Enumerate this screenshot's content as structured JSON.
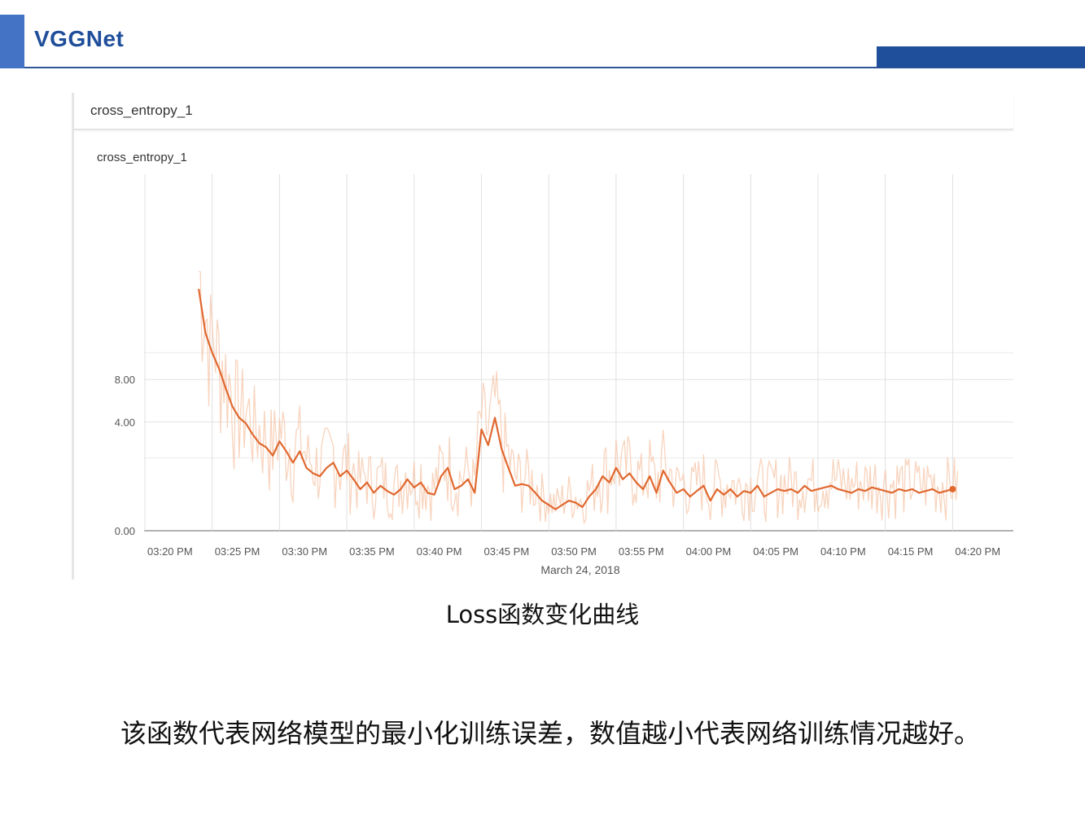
{
  "header": {
    "title": "VGGNet",
    "accent_color": "#4472c4",
    "brand_color": "#1f4e9a"
  },
  "card": {
    "tab_title": "cross_entropy_1"
  },
  "chart_data": {
    "type": "line",
    "title": "cross_entropy_1",
    "xlabel": "March 24, 2018",
    "ylabel": "",
    "x_tick_labels": [
      "03:20 PM",
      "03:25 PM",
      "03:30 PM",
      "03:35 PM",
      "03:40 PM",
      "03:45 PM",
      "03:50 PM",
      "03:55 PM",
      "04:00 PM",
      "04:05 PM",
      "04:10 PM",
      "04:15 PM",
      "04:20 PM"
    ],
    "y_tick_labels": [
      "0.00",
      "4.00",
      "8.00"
    ],
    "y_scale": "symmetric-log",
    "grid": true,
    "series": [
      {
        "color": "#e0682f",
        "smoothed_color": "#e0682f",
        "raw_color": "#f5c5a8",
        "x_minutes": [
          4,
          4.5,
          5,
          5.5,
          6,
          6.5,
          7,
          7.5,
          8,
          8.5,
          9,
          9.5,
          10,
          10.5,
          11,
          11.5,
          12,
          12.5,
          13,
          13.5,
          14,
          14.5,
          15,
          15.5,
          16,
          16.5,
          17,
          17.5,
          18,
          18.5,
          19,
          19.5,
          20,
          20.5,
          21,
          21.5,
          22,
          22.5,
          23,
          23.5,
          24,
          24.5,
          25,
          25.5,
          26,
          26.5,
          27,
          27.5,
          28,
          28.5,
          29,
          29.5,
          30,
          30.5,
          31,
          31.5,
          32,
          32.5,
          33,
          33.5,
          34,
          34.5,
          35,
          35.5,
          36,
          36.5,
          37,
          37.5,
          38,
          38.5,
          39,
          39.5,
          40,
          40.5,
          41,
          41.5,
          42,
          42.5,
          43,
          43.5,
          44,
          44.5,
          45,
          45.5,
          46,
          46.5,
          47,
          47.5,
          48,
          48.5,
          49,
          49.5,
          50,
          50.5,
          51,
          51.5,
          52,
          52.5,
          53,
          53.5,
          54,
          54.5,
          55,
          55.5,
          56,
          56.5,
          57,
          57.5,
          58,
          58.5,
          59,
          59.5,
          60
        ],
        "values": [
          30,
          16,
          12,
          9.5,
          7,
          5.2,
          4.3,
          3.9,
          3.2,
          2.7,
          2.5,
          2.1,
          2.8,
          2.3,
          1.8,
          2.3,
          1.6,
          1.4,
          1.3,
          1.6,
          1.8,
          1.3,
          1.5,
          1.2,
          0.9,
          1.1,
          0.8,
          1.0,
          0.85,
          0.75,
          0.9,
          1.2,
          0.95,
          1.1,
          0.8,
          0.75,
          1.3,
          1.6,
          0.9,
          1.0,
          1.2,
          0.8,
          3.5,
          2.6,
          4.3,
          2.4,
          1.6,
          1.0,
          1.05,
          1.0,
          0.8,
          0.6,
          0.5,
          0.4,
          0.5,
          0.6,
          0.55,
          0.45,
          0.7,
          0.9,
          1.3,
          1.1,
          1.6,
          1.2,
          1.4,
          1.1,
          0.9,
          1.3,
          0.8,
          1.5,
          1.1,
          0.8,
          0.9,
          0.7,
          0.85,
          1.0,
          0.6,
          0.9,
          0.75,
          0.9,
          0.7,
          0.85,
          0.8,
          1.0,
          0.7,
          0.8,
          0.9,
          0.85,
          0.9,
          0.8,
          1.0,
          0.85,
          0.9,
          0.95,
          1.0,
          0.9,
          0.85,
          0.8,
          0.9,
          0.85,
          0.95,
          0.9,
          0.85,
          0.8,
          0.9,
          0.85,
          0.9,
          0.8,
          0.85,
          0.9,
          0.8,
          0.85,
          0.9,
          0.8,
          0.85
        ]
      }
    ]
  },
  "caption": "Loss函数变化曲线",
  "description": "该函数代表网络模型的最小化训练误差，数值越小代表网络训练情况越好。"
}
